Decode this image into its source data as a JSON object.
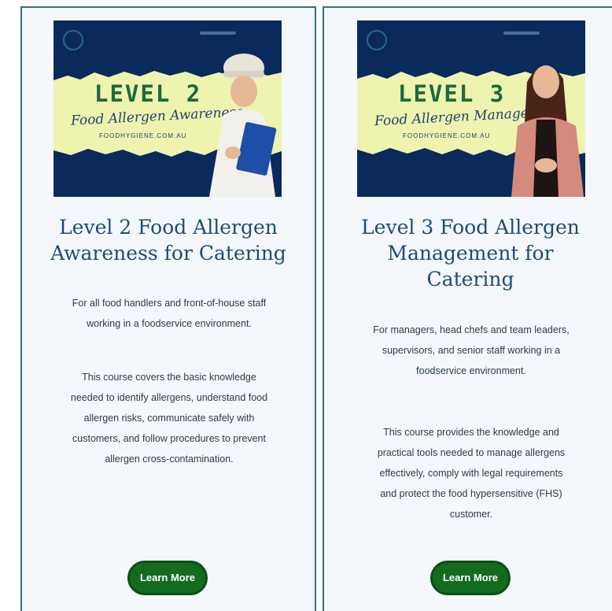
{
  "colors": {
    "banner_bg": "#0a2a5c",
    "banner_band": "#eef3b0",
    "title": "#1f4a78",
    "button": "#126b1f",
    "card_border": "#3a6b8f"
  },
  "cards": [
    {
      "banner": {
        "level": "LEVEL 2",
        "script_text": "Food Allergen Awareness",
        "url": "FOODHYGIENE.COM.AU"
      },
      "title_line1": "Level 2 Food Allergen",
      "title_line2": "Awareness for Catering",
      "audience_line1": "For all food handlers and front-of-house staff",
      "audience_line2": "working in a foodservice environment.",
      "summary_line1": "This course covers the basic knowledge",
      "summary_line2": "needed to identify allergens, understand food",
      "summary_line3": "allergen risks, communicate safely with",
      "summary_line4": "customers, and follow procedures to prevent",
      "summary_line5": "allergen cross-contamination.",
      "button_label": "Learn More"
    },
    {
      "banner": {
        "level": "LEVEL 3",
        "script_text": "Food Allergen Management",
        "url": "FOODHYGIENE.COM.AU"
      },
      "title_line1": "Level 3 Food Allergen",
      "title_line2": "Management for",
      "title_line3": "Catering",
      "audience_line1": "For managers, head chefs and team leaders,",
      "audience_line2": "supervisors, and senior staff working in a",
      "audience_line3": "foodservice environment.",
      "summary_line1": "This course provides the knowledge and",
      "summary_line2": "practical tools needed to manage allergens",
      "summary_line3": "effectively, comply with legal requirements",
      "summary_line4": "and protect the food hypersensitive (FHS)",
      "summary_line5": "customer.",
      "button_label": "Learn More"
    }
  ]
}
